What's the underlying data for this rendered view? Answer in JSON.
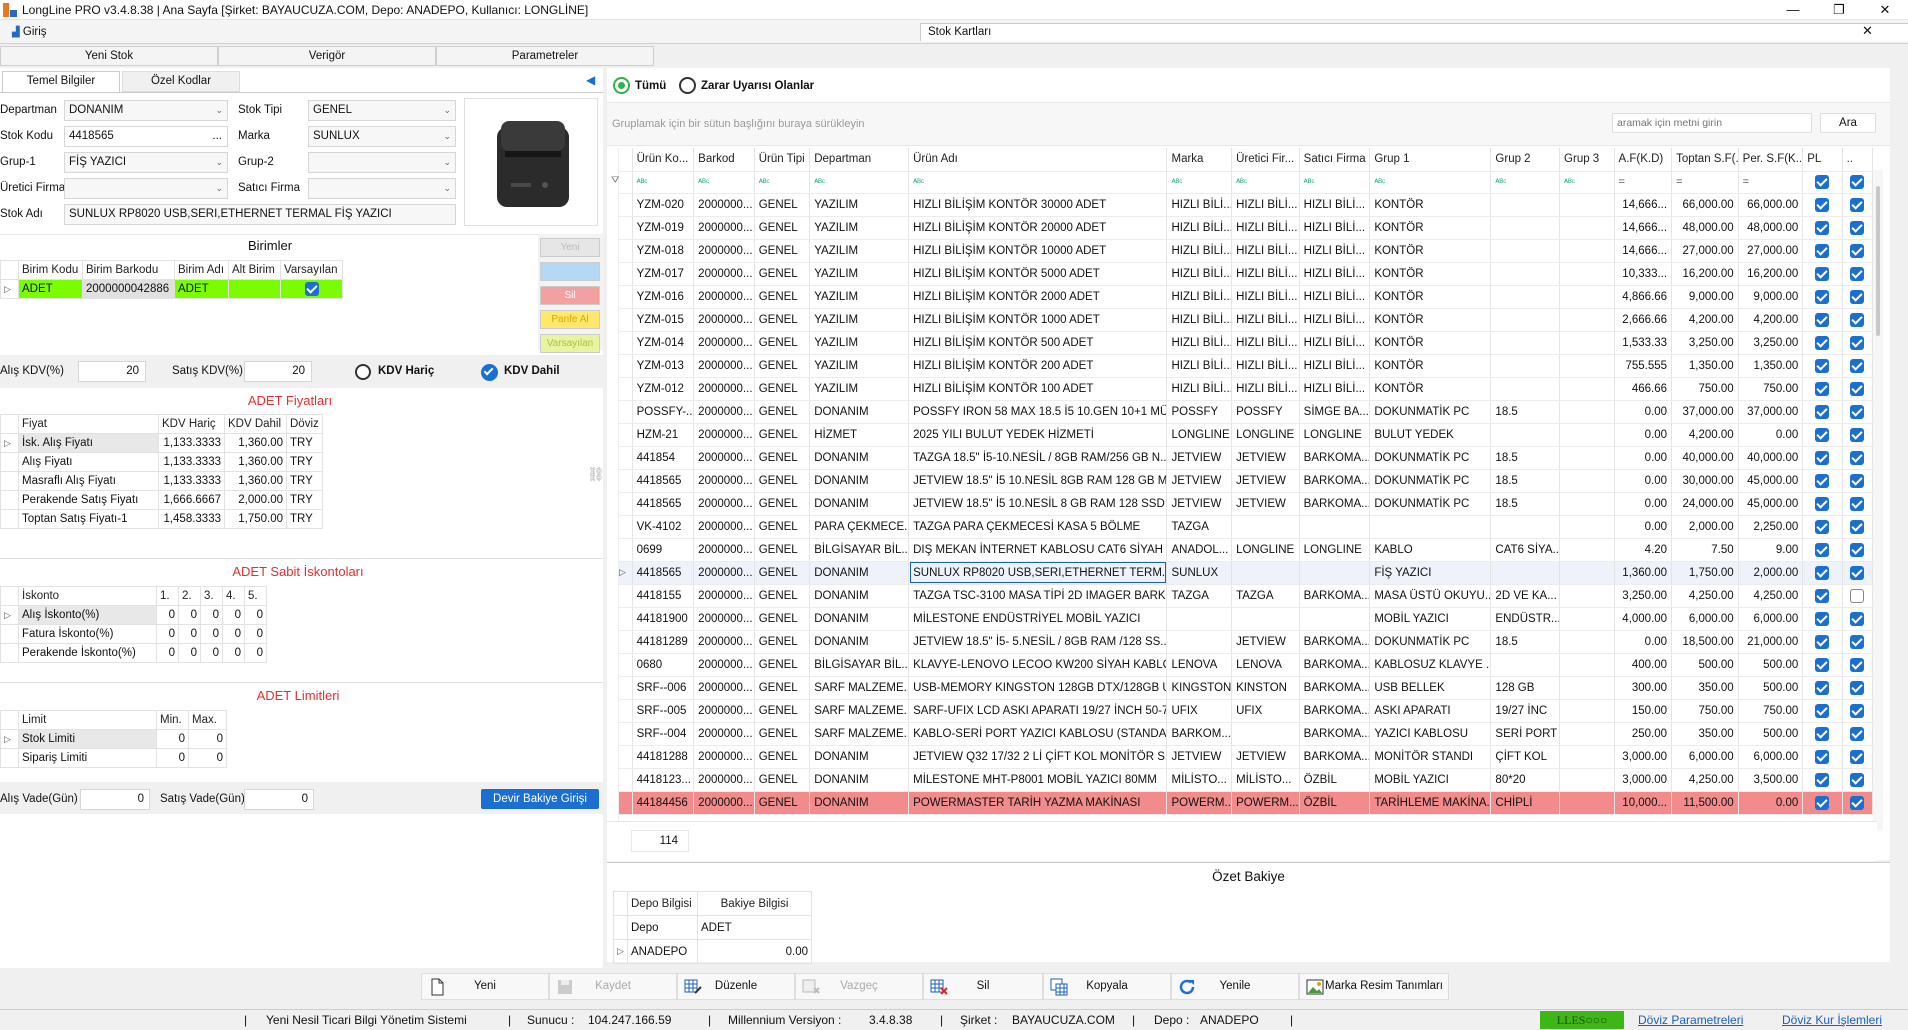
{
  "window": {
    "title": "LongLine PRO v3.4.8.38 | Ana Sayfa [Şirket: BAYAUCUZA.COM, Depo: ANADEPO, Kullanıcı: LONGLİNE]",
    "doc_tab": "Giriş",
    "center_tab": "Stok Kartları"
  },
  "left_tabs": [
    "Yeni Stok",
    "Verigör",
    "Parametreler"
  ],
  "sub_tabs": [
    "Temel Bilgiler",
    "Özel Kodlar"
  ],
  "form": {
    "departman_label": "Departman",
    "departman": "DONANIM",
    "stok_tipi_label": "Stok Tipi",
    "stok_tipi": "GENEL",
    "stok_kodu_label": "Stok Kodu",
    "stok_kodu": "4418565",
    "stok_kodu_ellipsis": "...",
    "marka_label": "Marka",
    "marka": "SUNLUX",
    "grup1_label": "Grup-1",
    "grup1": "FİŞ YAZICI",
    "grup2_label": "Grup-2",
    "grup2": "",
    "uretici_label": "Üretici Firma",
    "uretici": "",
    "satici_label": "Satıcı Firma",
    "satici": "",
    "stok_adi_label": "Stok Adı",
    "stok_adi": "SUNLUX RP8020 USB,SERI,ETHERNET  TERMAL FİŞ YAZICI"
  },
  "birimler": {
    "title": "Birimler",
    "headers": [
      "Birim Kodu",
      "Birim Barkodu",
      "Birim Adı",
      "Alt Birim",
      "Varsayılan"
    ],
    "row": [
      "ADET",
      "2000000042886",
      "ADET",
      ""
    ],
    "side_buttons": [
      "Yeni",
      "",
      "Sil",
      "Panfe Al",
      "Varsayılan"
    ]
  },
  "kdv": {
    "alis_label": "Alış KDV(%)",
    "alis": "20",
    "satis_label": "Satış KDV(%)",
    "satis": "20",
    "haric": "KDV Hariç",
    "dahil": "KDV Dahil"
  },
  "fiyatlar": {
    "title": "ADET Fiyatları",
    "headers": [
      "Fiyat",
      "KDV Hariç",
      "KDV Dahil",
      "Döviz"
    ],
    "rows": [
      [
        "İsk. Alış Fiyatı",
        "1,133.3333",
        "1,360.00",
        "TRY"
      ],
      [
        "Alış Fiyatı",
        "1,133.3333",
        "1,360.00",
        "TRY"
      ],
      [
        "Masraflı Alış Fiyatı",
        "1,133.3333",
        "1,360.00",
        "TRY"
      ],
      [
        "Perakende Satış Fiyatı",
        "1,666.6667",
        "2,000.00",
        "TRY"
      ],
      [
        "Toptan Satış Fiyatı-1",
        "1,458.3333",
        "1,750.00",
        "TRY"
      ]
    ]
  },
  "iskonto": {
    "title": "ADET Sabit İskontoları",
    "headers": [
      "İskonto",
      "1.",
      "2.",
      "3.",
      "4.",
      "5."
    ],
    "rows": [
      [
        "Alış İskonto(%)",
        "0",
        "0",
        "0",
        "0",
        "0"
      ],
      [
        "Fatura İskonto(%)",
        "0",
        "0",
        "0",
        "0",
        "0"
      ],
      [
        "Perakende İskonto(%)",
        "0",
        "0",
        "0",
        "0",
        "0"
      ]
    ]
  },
  "limitler": {
    "title": "ADET Limitleri",
    "headers": [
      "Limit",
      "Min.",
      "Max."
    ],
    "rows": [
      [
        "Stok Limiti",
        "0",
        "0"
      ],
      [
        "Sipariş Limiti",
        "0",
        "0"
      ]
    ]
  },
  "vade": {
    "alis_label": "Alış Vade(Gün)",
    "alis": "0",
    "satis_label": "Satış Vade(Gün)",
    "satis": "0",
    "devir_button": "Devir Bakiye Girişi"
  },
  "right": {
    "radio_all": "Tümü",
    "radio_zarar": "Zarar Uyarısı Olanlar",
    "group_hint": "Gruplamak için bir sütun başlığını buraya sürükleyin",
    "search_placeholder": "aramak için metni girin",
    "search_button": "Ara",
    "record_count": "114"
  },
  "grid": {
    "headers": [
      "Ürün Ko...",
      "Barkod",
      "Ürün Tipi",
      "Departman",
      "Ürün Adı",
      "Marka",
      "Üretici Fir...",
      "Satıcı Firma",
      "Grup 1",
      "Grup 2",
      "Grup 3",
      "A.F(K.D)",
      "Toptan S.F(...",
      "Per. S.F(K...",
      "PL",
      ".."
    ],
    "filter_glyph": "ᴬᴮᶜ",
    "num_filter_glyph": "=",
    "rows": [
      [
        "YZM-020",
        "2000000...",
        "GENEL",
        "YAZILIM",
        "HIZLI BİLİŞİM KONTÖR 30000 ADET",
        "HIZLI BİLİ...",
        "HIZLI BİLİ...",
        "HIZLI BİLİ...",
        "KONTÖR",
        "",
        "",
        "14,666...",
        "66,000.00",
        "66,000.00",
        1,
        1
      ],
      [
        "YZM-019",
        "2000000...",
        "GENEL",
        "YAZILIM",
        "HIZLI BİLİŞİM KONTÖR 20000 ADET",
        "HIZLI BİLİ...",
        "HIZLI BİLİ...",
        "HIZLI BİLİ...",
        "KONTÖR",
        "",
        "",
        "14,666...",
        "48,000.00",
        "48,000.00",
        1,
        1
      ],
      [
        "YZM-018",
        "2000000...",
        "GENEL",
        "YAZILIM",
        "HIZLI BİLİŞİM KONTÖR 10000 ADET",
        "HIZLI BİLİ...",
        "HIZLI BİLİ...",
        "HIZLI BİLİ...",
        "KONTÖR",
        "",
        "",
        "14,666...",
        "27,000.00",
        "27,000.00",
        1,
        1
      ],
      [
        "YZM-017",
        "2000000...",
        "GENEL",
        "YAZILIM",
        "HIZLI BİLİŞİM KONTÖR 5000 ADET",
        "HIZLI BİLİ...",
        "HIZLI BİLİ...",
        "HIZLI BİLİ...",
        "KONTÖR",
        "",
        "",
        "10,333...",
        "16,200.00",
        "16,200.00",
        1,
        1
      ],
      [
        "YZM-016",
        "2000000...",
        "GENEL",
        "YAZILIM",
        "HIZLI BİLİŞİM KONTÖR 2000 ADET",
        "HIZLI BİLİ...",
        "HIZLI BİLİ...",
        "HIZLI BİLİ...",
        "KONTÖR",
        "",
        "",
        "4,866.66",
        "9,000.00",
        "9,000.00",
        1,
        1
      ],
      [
        "YZM-015",
        "2000000...",
        "GENEL",
        "YAZILIM",
        "HIZLI BİLİŞİM KONTÖR 1000 ADET",
        "HIZLI BİLİ...",
        "HIZLI BİLİ...",
        "HIZLI BİLİ...",
        "KONTÖR",
        "",
        "",
        "2,666.66",
        "4,200.00",
        "4,200.00",
        1,
        1
      ],
      [
        "YZM-014",
        "2000000...",
        "GENEL",
        "YAZILIM",
        "HIZLI BİLİŞİM KONTÖR 500 ADET",
        "HIZLI BİLİ...",
        "HIZLI BİLİ...",
        "HIZLI BİLİ...",
        "KONTÖR",
        "",
        "",
        "1,533.33",
        "3,250.00",
        "3,250.00",
        1,
        1
      ],
      [
        "YZM-013",
        "2000000...",
        "GENEL",
        "YAZILIM",
        "HIZLI BİLİŞİM KONTÖR 200 ADET",
        "HIZLI BİLİ...",
        "HIZLI BİLİ...",
        "HIZLI BİLİ...",
        "KONTÖR",
        "",
        "",
        "755.555",
        "1,350.00",
        "1,350.00",
        1,
        1
      ],
      [
        "YZM-012",
        "2000000...",
        "GENEL",
        "YAZILIM",
        "HIZLI BİLİŞİM KONTÖR 100 ADET",
        "HIZLI BİLİ...",
        "HIZLI BİLİ...",
        "HIZLI BİLİ...",
        "KONTÖR",
        "",
        "",
        "466.66",
        "750.00",
        "750.00",
        1,
        1
      ],
      [
        "POSSFY-...",
        "2000000...",
        "GENEL",
        "DONANIM",
        "POSSFY IRON 58 MAX 18.5 İ5 10.GEN 10+1 MÜ...",
        "POSSFY",
        "POSSFY",
        "SİMGE BA...",
        "DOKUNMATİK PC",
        "18.5",
        "",
        "0.00",
        "37,000.00",
        "37,000.00",
        1,
        1
      ],
      [
        "HZM-21",
        "2000000...",
        "GENEL",
        "HİZMET",
        "2025 YILI BULUT YEDEK HİZMETİ",
        "LONGLINE",
        "LONGLINE",
        "LONGLINE",
        "BULUT YEDEK",
        "",
        "",
        "0.00",
        "4,200.00",
        "0.00",
        1,
        1
      ],
      [
        "441854",
        "2000000...",
        "GENEL",
        "DONANIM",
        "TAZGA 18.5\" İ5-10.NESİL / 8GB RAM/256 GB N...",
        "JETVIEW",
        "JETVIEW",
        "BARKOMA...",
        "DOKUNMATİK PC",
        "18.5",
        "",
        "0.00",
        "40,000.00",
        "40,000.00",
        1,
        1
      ],
      [
        "4418565",
        "2000000...",
        "GENEL",
        "DONANIM",
        "JETVIEW 18.5\" İ5 10.NESİL 8GB RAM 128 GB M...",
        "JETVIEW",
        "JETVIEW",
        "BARKOMA...",
        "DOKUNMATİK PC",
        "18.5",
        "",
        "0.00",
        "30,000.00",
        "45,000.00",
        1,
        1
      ],
      [
        "4418565",
        "2000000...",
        "GENEL",
        "DONANIM",
        "JETVIEW 18.5\" İ5 10.NESİL 8 GB RAM 128 SSD ...",
        "JETVIEW",
        "JETVIEW",
        "BARKOMA...",
        "DOKUNMATİK PC",
        "18.5",
        "",
        "0.00",
        "24,000.00",
        "45,000.00",
        1,
        1
      ],
      [
        "VK-4102",
        "2000000...",
        "GENEL",
        "PARA ÇEKMECE...",
        "TAZGA PARA ÇEKMECESİ KASA 5 BÖLME",
        "TAZGA",
        "",
        "",
        "",
        "",
        "",
        "0.00",
        "2,000.00",
        "2,250.00",
        1,
        1
      ],
      [
        "0699",
        "2000000...",
        "GENEL",
        "BİLGİSAYAR BİL...",
        "DIŞ MEKAN İNTERNET KABLOSU  CAT6 SİYAH ...",
        "ANADOL...",
        "LONGLINE",
        "LONGLINE",
        "KABLO",
        "CAT6 SİYA...",
        "",
        "4.20",
        "7.50",
        "9.00",
        1,
        1
      ],
      [
        "4418565",
        "2000000...",
        "GENEL",
        "DONANIM",
        "SUNLUX RP8020 USB,SERI,ETHERNET  TERM...",
        "SUNLUX",
        "",
        "",
        "FİŞ YAZICI",
        "",
        "",
        "1,360.00",
        "1,750.00",
        "2,000.00",
        1,
        1
      ],
      [
        "4418155",
        "2000000...",
        "GENEL",
        "DONANIM",
        "TAZGA TSC-3100 MASA TİPİ 2D IMAGER BARK...",
        "TAZGA",
        "TAZGA",
        "BARKOMA...",
        "MASA ÜSTÜ OKUYU...",
        "2D VE KA...",
        "",
        "3,250.00",
        "4,250.00",
        "4,250.00",
        1,
        0
      ],
      [
        "44181900",
        "2000000...",
        "GENEL",
        "DONANIM",
        "MİLESTONE ENDÜSTRİYEL MOBİL YAZICI",
        "",
        "",
        "",
        "MOBİL YAZICI",
        "ENDÜSTR...",
        "",
        "4,000.00",
        "6,000.00",
        "6,000.00",
        1,
        1
      ],
      [
        "44181289",
        "2000000...",
        "GENEL",
        "DONANIM",
        "JETVIEW 18.5\" İ5- 5.NESİL / 8GB RAM /128 SS...",
        "",
        "JETVIEW",
        "BARKOMA...",
        "DOKUNMATİK PC",
        "18.5",
        "",
        "0.00",
        "18,500.00",
        "21,000.00",
        1,
        1
      ],
      [
        "0680",
        "2000000...",
        "GENEL",
        "BİLGİSAYAR BİL...",
        "KLAVYE-LENOVO LECOO KW200 SİYAH KABLO...",
        "LENOVA",
        "LENOVA",
        "BARKOMA...",
        "KABLOSUZ KLAVYE ...",
        "",
        "",
        "400.00",
        "500.00",
        "500.00",
        1,
        1
      ],
      [
        "SRF--006",
        "2000000...",
        "GENEL",
        "SARF MALZEME...",
        "USB-MEMORY KINGSTON 128GB DTX/128GB U...",
        "KINGSTON",
        "KINSTON",
        "BARKOMA...",
        "USB BELLEK",
        "128 GB",
        "",
        "300.00",
        "350.00",
        "500.00",
        1,
        1
      ],
      [
        "SRF--005",
        "2000000...",
        "GENEL",
        "SARF MALZEME...",
        "SARF-UFIX LCD ASKI APARATI 19/27 İNCH 50-7...",
        "UFIX",
        "UFIX",
        "BARKOMA...",
        "ASKI APARATI",
        "19/27 İNC",
        "",
        "150.00",
        "750.00",
        "750.00",
        1,
        1
      ],
      [
        "SRF--004",
        "2000000...",
        "GENEL",
        "SARF MALZEME...",
        "KABLO-SERİ PORT YAZICI KABLOSU (STANDA...",
        "BARKOM...",
        "",
        "BARKOMA...",
        "YAZICI KABLOSU",
        "SERİ PORT",
        "",
        "250.00",
        "350.00",
        "500.00",
        1,
        1
      ],
      [
        "44181288",
        "2000000...",
        "GENEL",
        "DONANIM",
        "JETVIEW Q32 17/32 2 Lİ ÇİFT KOL  MONİTÖR S...",
        "JETVIEW",
        "JETVIEW",
        "BARKOMA...",
        "MONİTÖR STANDI",
        "ÇİFT KOL",
        "",
        "3,000.00",
        "6,000.00",
        "6,000.00",
        1,
        1
      ],
      [
        "4418123...",
        "2000000...",
        "GENEL",
        "DONANIM",
        "MİLESTONE  MHT-P8001 MOBİL YAZICI 80MM",
        "MİLİSTO...",
        "MİLİSTO...",
        "ÖZBİL",
        "MOBİL YAZICI",
        "80*20",
        "",
        "3,000.00",
        "4,250.00",
        "3,500.00",
        1,
        1
      ],
      [
        "44184456",
        "2000000...",
        "GENEL",
        "DONANIM",
        "POWERMASTER TARİH YAZMA MAKİNASI",
        "POWERM...",
        "POWERM...",
        "ÖZBİL",
        "TARİHLEME MAKİNA...",
        "CHİPLİ",
        "",
        "10,000...",
        "11,500.00",
        "0.00",
        1,
        1
      ]
    ],
    "selected_row": 16,
    "red_row": 26
  },
  "ozet": {
    "title": "Özet Bakiye",
    "headers": [
      "Depo Bilgisi",
      "Bakiye Bilgisi"
    ],
    "sub_headers": [
      "Depo",
      "ADET"
    ],
    "row": [
      "ANADEPO",
      "0.00"
    ]
  },
  "toolbar": {
    "yeni": "Yeni",
    "kaydet": "Kaydet",
    "duzenle": "Düzenle",
    "vazgec": "Vazgeç",
    "sil": "Sil",
    "kopyala": "Kopyala",
    "yenile": "Yenile",
    "marka": "Marka Resim Tanımları"
  },
  "status": {
    "app": "Yeni Nesil Ticari Bilgi Yönetim Sistemi",
    "sunucu_label": "Sunucu :",
    "sunucu": "104.247.166.59",
    "versiyon_label": "Millennium Versiyon :",
    "versiyon": "3.4.8.38",
    "sirket_label": "Şirket :",
    "sirket": "BAYAUCUZA.COM",
    "depo_label": "Depo :",
    "depo": "ANADEPO",
    "badge": "LLES○○○",
    "doviz_param": "Döviz Parametreleri",
    "doviz_kur": "Döviz Kur İşlemleri"
  },
  "colors": {
    "accent": "#1b6fd1",
    "green": "#7cfc00",
    "red_row": "#f28b8b",
    "title_red": "#e03030"
  }
}
